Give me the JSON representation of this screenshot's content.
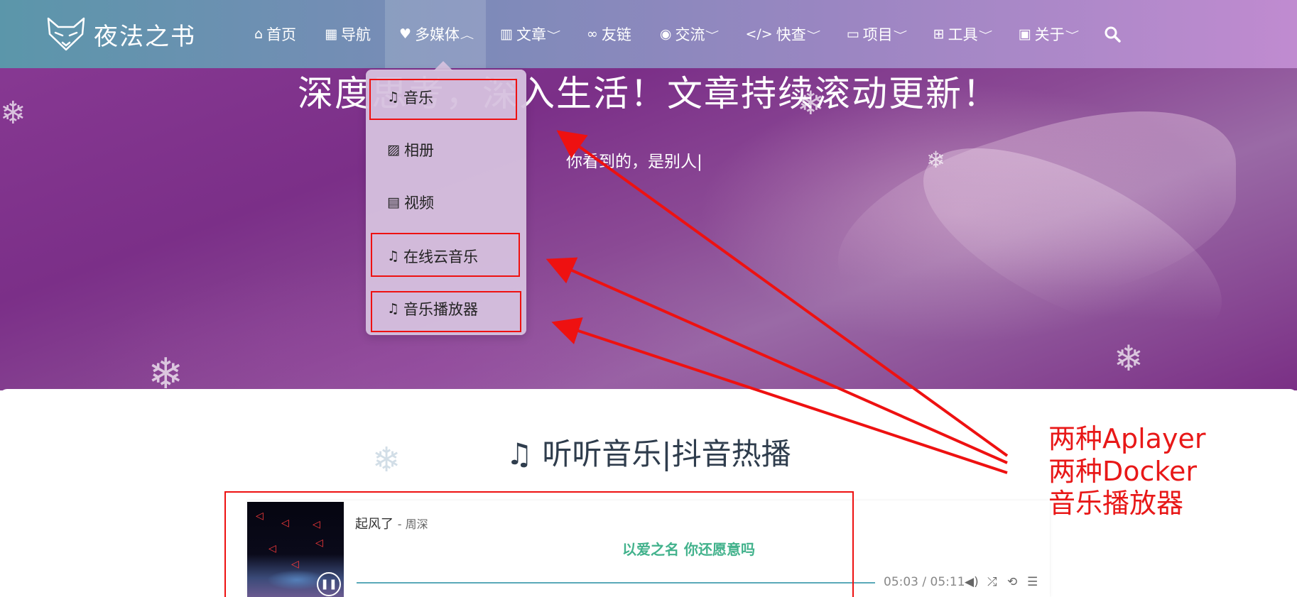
{
  "brand": {
    "name": "夜法之书",
    "logo_icon": "fox-logo-icon"
  },
  "nav": {
    "items": [
      {
        "label": "首页",
        "icon": "home-icon",
        "glyph": "⌂",
        "dropdown": false
      },
      {
        "label": "导航",
        "icon": "briefcase-icon",
        "glyph": "▦",
        "dropdown": false
      },
      {
        "label": "多媒体",
        "icon": "heart-icon",
        "glyph": "♥",
        "dropdown": true,
        "open": true
      },
      {
        "label": "文章",
        "icon": "chart-icon",
        "glyph": "▥",
        "dropdown": true
      },
      {
        "label": "友链",
        "icon": "link-icon",
        "glyph": "∞",
        "dropdown": false
      },
      {
        "label": "交流",
        "icon": "comments-icon",
        "glyph": "◉",
        "dropdown": true
      },
      {
        "label": "快查",
        "icon": "code-icon",
        "glyph": "</>",
        "dropdown": true
      },
      {
        "label": "项目",
        "icon": "laptop-icon",
        "glyph": "▭",
        "dropdown": true
      },
      {
        "label": "工具",
        "icon": "toolbox-icon",
        "glyph": "⊞",
        "dropdown": true
      },
      {
        "label": "关于",
        "icon": "id-card-icon",
        "glyph": "▣",
        "dropdown": true
      }
    ],
    "search_icon": "search-icon"
  },
  "hero": {
    "headline": "深度思考，深入生活！文章持续滚动更新！",
    "subline": "你看到的，是别人|"
  },
  "dropdown": {
    "items": [
      {
        "label": "音乐",
        "icon": "music-icon",
        "glyph": "♫"
      },
      {
        "label": "相册",
        "icon": "image-icon",
        "glyph": "▨"
      },
      {
        "label": "视频",
        "icon": "film-icon",
        "glyph": "▤"
      },
      {
        "label": "在线云音乐",
        "icon": "music-icon",
        "glyph": "♫"
      },
      {
        "label": "音乐播放器",
        "icon": "music-icon",
        "glyph": "♫"
      }
    ]
  },
  "section": {
    "title": "听听音乐|抖音热播",
    "icon": "music-icon"
  },
  "player": {
    "title": "起风了",
    "artist": "- 周深",
    "lyric": "以爱之名 你还愿意吗",
    "time": "05:03 / 05:11",
    "progress": 0.97,
    "controls": [
      "volume-icon",
      "shuffle-icon",
      "repeat-icon",
      "playlist-icon"
    ]
  },
  "annotation": {
    "lines": [
      "两种Aplayer",
      "两种Docker",
      "音乐播放器"
    ],
    "color": "#e81818"
  }
}
